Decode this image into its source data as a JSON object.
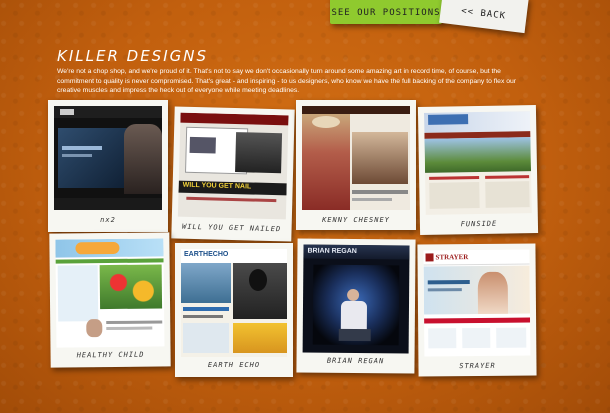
{
  "nav": {
    "positions_label": "SEE OUR POSITIONS",
    "back_label": "<< BACK"
  },
  "section": {
    "title": "KILLER DESIGNS",
    "intro": "We're not a chop shop, and we're proud of it. That's not to say we don't occasionally turn around some amazing art in record time, of course, but the commitment to quality is never compromised. That's great - and inspiring - to us designers, who know we have the full backing of the company to flex our creative muscles and impress the heck out of everyone while meeting deadlines."
  },
  "designs": [
    {
      "caption": "nx2"
    },
    {
      "caption": "WILL YOU GET NAILED",
      "photo_text": "WILL YOU GET NAIL"
    },
    {
      "caption": "KENNY CHESNEY"
    },
    {
      "caption": "FUNSIDE"
    },
    {
      "caption": "HEALTHY CHILD"
    },
    {
      "caption": "EARTH ECHO",
      "photo_text": "EARTHECHO"
    },
    {
      "caption": "BRIAN REGAN",
      "photo_text": "BRIAN REGAN"
    },
    {
      "caption": "STRAYER",
      "photo_text": "STRAYER"
    }
  ],
  "colors": {
    "background": "#c15f0e",
    "tab_green": "#8fca2e",
    "paper": "#f7f7f2"
  }
}
